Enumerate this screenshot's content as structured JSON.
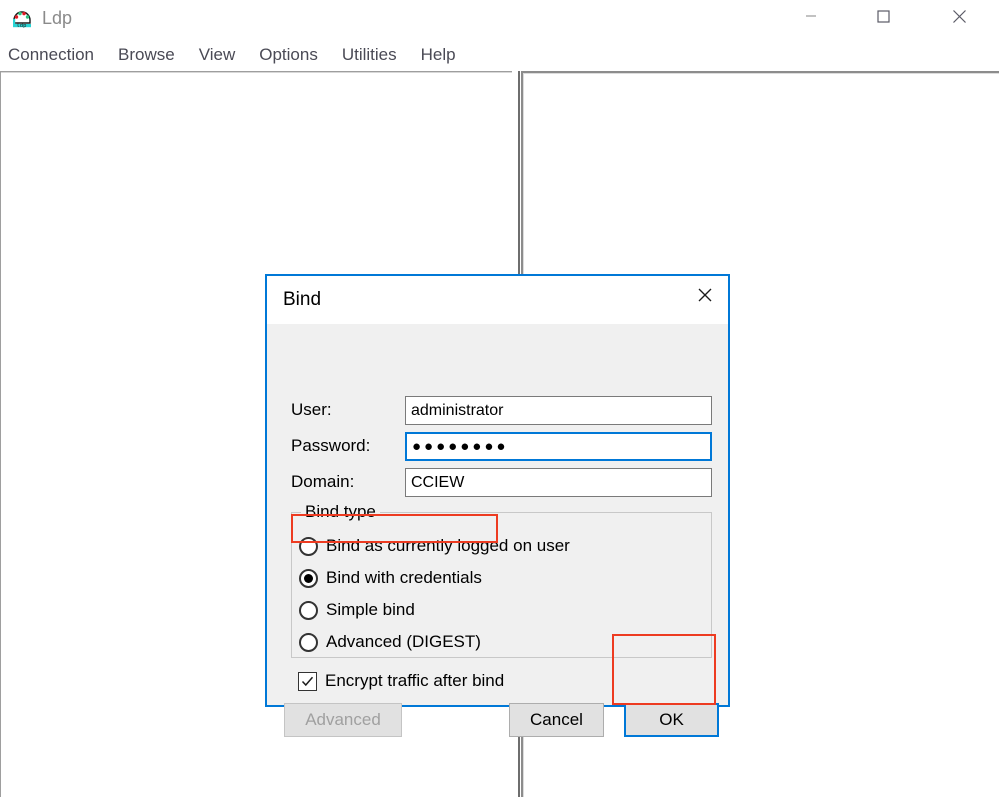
{
  "window": {
    "title": "Ldp",
    "icon": "ldp-app-icon",
    "controls": {
      "minimize": "minimize-icon",
      "maximize": "maximize-icon",
      "close": "close-icon"
    }
  },
  "menubar": {
    "items": [
      {
        "label": "Connection"
      },
      {
        "label": "Browse"
      },
      {
        "label": "View"
      },
      {
        "label": "Options"
      },
      {
        "label": "Utilities"
      },
      {
        "label": "Help"
      }
    ]
  },
  "panes": {
    "left": {
      "content": ""
    },
    "right": {
      "content": ""
    }
  },
  "dialog": {
    "title": "Bind",
    "close_icon": "close-icon",
    "fields": [
      {
        "label": "User:",
        "value": "administrator",
        "placeholder": "",
        "focused": false
      },
      {
        "label": "Password:",
        "value": "●●●●●●●●",
        "placeholder": "",
        "focused": true
      },
      {
        "label": "Domain:",
        "value": "CCIEW",
        "placeholder": "",
        "focused": false
      }
    ],
    "bind_type": {
      "legend": "Bind type",
      "options": [
        {
          "label": "Bind as currently logged on user",
          "selected": false
        },
        {
          "label": "Bind with credentials",
          "selected": true
        },
        {
          "label": "Simple bind",
          "selected": false
        },
        {
          "label": "Advanced (DIGEST)",
          "selected": false
        }
      ]
    },
    "encrypt": {
      "label": "Encrypt traffic after bind",
      "checked": true
    },
    "buttons": {
      "advanced": "Advanced",
      "cancel": "Cancel",
      "ok": "OK"
    }
  },
  "annotations": {
    "highlight_color": "#ed3b21",
    "items": [
      {
        "target": "Bind with credentials"
      },
      {
        "target": "OK"
      }
    ]
  }
}
